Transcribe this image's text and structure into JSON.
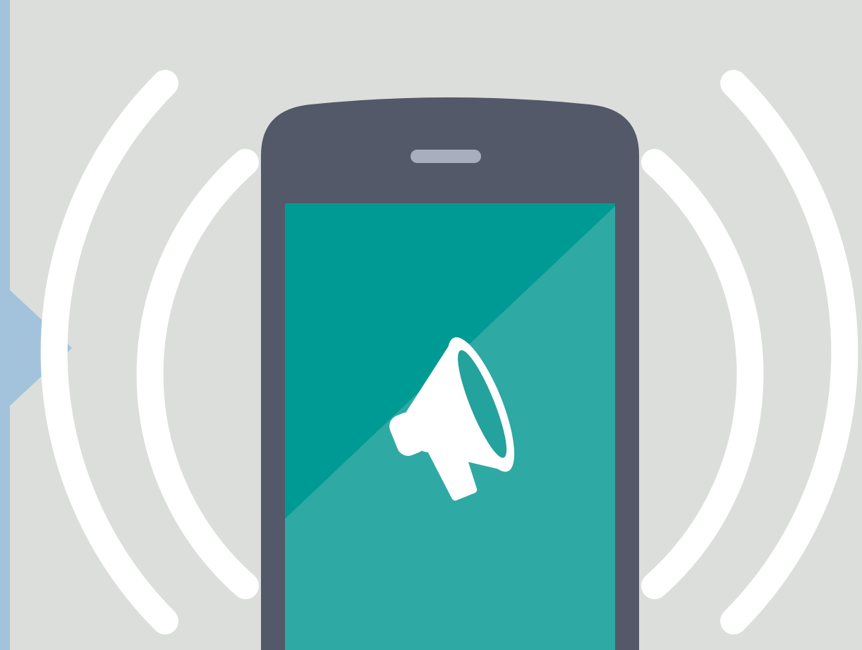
{
  "illustration": {
    "subject": "smartphone-with-megaphone",
    "icons": {
      "screen_icon": "megaphone-icon",
      "speaker": "phone-speaker-icon",
      "side_pointer": "arrow-right-icon"
    },
    "colors": {
      "background": "#dcdedb",
      "side_panel": "#a3c3dc",
      "phone_body": "#535968",
      "speaker": "#a8aebe",
      "screen_dark": "#009a94",
      "screen_light": "#2fa9a4",
      "waves": "#ffffff",
      "megaphone": "#ffffff"
    }
  }
}
